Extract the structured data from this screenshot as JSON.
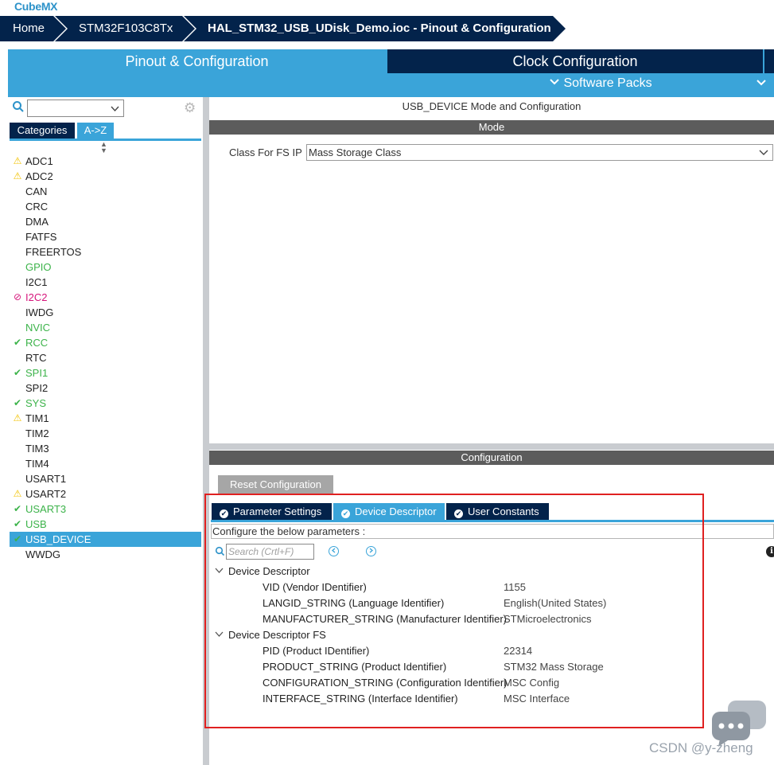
{
  "app": {
    "logo_prefix": "Cube",
    "logo_suffix": "MX"
  },
  "breadcrumb": {
    "items": [
      "Home",
      "STM32F103C8Tx",
      "HAL_STM32_USB_UDisk_Demo.ioc - Pinout & Configuration"
    ]
  },
  "main_tabs": {
    "pinout": "Pinout & Configuration",
    "clock": "Clock Configuration",
    "software_packs": "Software Packs"
  },
  "left": {
    "categories_tab": "Categories",
    "az_tab": "A->Z",
    "peripherals": [
      {
        "name": "ADC1",
        "status": "warn",
        "color": "normal"
      },
      {
        "name": "ADC2",
        "status": "warn",
        "color": "normal"
      },
      {
        "name": "CAN",
        "status": "",
        "color": "normal"
      },
      {
        "name": "CRC",
        "status": "",
        "color": "normal"
      },
      {
        "name": "DMA",
        "status": "",
        "color": "normal"
      },
      {
        "name": "FATFS",
        "status": "",
        "color": "normal"
      },
      {
        "name": "FREERTOS",
        "status": "",
        "color": "normal"
      },
      {
        "name": "GPIO",
        "status": "",
        "color": "green"
      },
      {
        "name": "I2C1",
        "status": "",
        "color": "normal"
      },
      {
        "name": "I2C2",
        "status": "no",
        "color": "pink"
      },
      {
        "name": "IWDG",
        "status": "",
        "color": "normal"
      },
      {
        "name": "NVIC",
        "status": "",
        "color": "green"
      },
      {
        "name": "RCC",
        "status": "ok",
        "color": "green"
      },
      {
        "name": "RTC",
        "status": "",
        "color": "normal"
      },
      {
        "name": "SPI1",
        "status": "ok",
        "color": "green"
      },
      {
        "name": "SPI2",
        "status": "",
        "color": "normal"
      },
      {
        "name": "SYS",
        "status": "ok",
        "color": "green"
      },
      {
        "name": "TIM1",
        "status": "warn",
        "color": "normal"
      },
      {
        "name": "TIM2",
        "status": "",
        "color": "normal"
      },
      {
        "name": "TIM3",
        "status": "",
        "color": "normal"
      },
      {
        "name": "TIM4",
        "status": "",
        "color": "normal"
      },
      {
        "name": "USART1",
        "status": "",
        "color": "normal"
      },
      {
        "name": "USART2",
        "status": "warn",
        "color": "normal"
      },
      {
        "name": "USART3",
        "status": "ok",
        "color": "green"
      },
      {
        "name": "USB",
        "status": "ok",
        "color": "green"
      },
      {
        "name": "USB_DEVICE",
        "status": "ok",
        "color": "selected"
      },
      {
        "name": "WWDG",
        "status": "",
        "color": "normal"
      }
    ]
  },
  "mode": {
    "title": "USB_DEVICE Mode and Configuration",
    "header": "Mode",
    "class_label": "Class For FS IP",
    "class_value": "Mass Storage Class"
  },
  "config": {
    "header": "Configuration",
    "reset_button": "Reset Configuration",
    "tabs": [
      "Parameter Settings",
      "Device Descriptor",
      "User Constants"
    ],
    "configure_text": "Configure the below parameters :",
    "search_placeholder": "Search (Crtl+F)",
    "groups": [
      {
        "title": "Device Descriptor",
        "rows": [
          {
            "key": "VID (Vendor IDentifier)",
            "value": "1155"
          },
          {
            "key": "LANGID_STRING (Language Identifier)",
            "value": "English(United States)"
          },
          {
            "key": "MANUFACTURER_STRING (Manufacturer Identifier)",
            "value": "STMicroelectronics"
          }
        ]
      },
      {
        "title": "Device Descriptor FS",
        "rows": [
          {
            "key": "PID (Product IDentifier)",
            "value": "22314"
          },
          {
            "key": "PRODUCT_STRING (Product Identifier)",
            "value": "STM32 Mass Storage"
          },
          {
            "key": "CONFIGURATION_STRING (Configuration Identifier)",
            "value": "MSC Config"
          },
          {
            "key": "INTERFACE_STRING (Interface Identifier)",
            "value": "MSC Interface"
          }
        ]
      }
    ]
  },
  "watermark": "CSDN @y-zheng",
  "colors": {
    "navy": "#03234b",
    "accent": "#3aa4d9",
    "ok": "#3cb34a",
    "error": "#d6157b",
    "warn": "#f2c200",
    "highlight": "#e02020"
  }
}
